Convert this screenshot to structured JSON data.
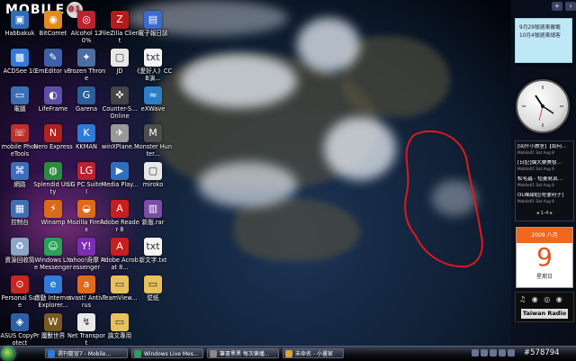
{
  "brand": {
    "logo_text": "MOBILE",
    "logo_badge": "01"
  },
  "desktop_icons": [
    {
      "name": "icon-habbakuk",
      "label": "Habbakuk",
      "color": "#2e6bb8",
      "glyph": "▣"
    },
    {
      "name": "icon-bitcomet",
      "label": "BitComet",
      "color": "#e48a1b",
      "glyph": "◉"
    },
    {
      "name": "icon-alcohol",
      "label": "Alcohol 120%",
      "color": "#b8232e",
      "glyph": "◎"
    },
    {
      "name": "icon-filezilla",
      "label": "FileZilla Client",
      "color": "#b51b1b",
      "glyph": "Z"
    },
    {
      "name": "icon-ultraedit",
      "label": "電子報日誌",
      "color": "#3b6bd1",
      "glyph": "▤"
    },
    {
      "name": "icon-acdsee",
      "label": "ACDSee 10",
      "color": "#2f7bd9",
      "glyph": "▩"
    },
    {
      "name": "icon-emeditor",
      "label": "EmEditor v3",
      "color": "#3f5fa8",
      "glyph": "✎"
    },
    {
      "name": "icon-frozen-throne",
      "label": "Frozen Throne",
      "color": "#4d6fa0",
      "glyph": "✦"
    },
    {
      "name": "icon-jd",
      "label": "JD",
      "color": "#e8e8e8",
      "glyph": "▢"
    },
    {
      "name": "icon-ccb",
      "label": "《愛好人》CCB演...",
      "color": "#f4f4f4",
      "glyph": "txt"
    },
    {
      "name": "icon-computer",
      "label": "電腦",
      "color": "#3a6fb8",
      "glyph": "▭"
    },
    {
      "name": "icon-lifeframe",
      "label": "LifeFrame",
      "color": "#5d4fa8",
      "glyph": "◐"
    },
    {
      "name": "icon-garena",
      "label": "Garena",
      "color": "#2a5f99",
      "glyph": "G"
    },
    {
      "name": "icon-counter-strike",
      "label": "Counter-S... Online",
      "color": "#444",
      "glyph": "✜"
    },
    {
      "name": "icon-wave",
      "label": "eXWave",
      "color": "#2b7fc9",
      "glyph": "≈"
    },
    {
      "name": "icon-mobile-phonetools",
      "label": "mobile PhoneTools",
      "color": "#be2e2e",
      "glyph": "☏"
    },
    {
      "name": "icon-nero-express",
      "label": "Nero Express",
      "color": "#ad2222",
      "glyph": "N"
    },
    {
      "name": "icon-kkman",
      "label": "KKMAN",
      "color": "#2d7bd4",
      "glyph": "K"
    },
    {
      "name": "icon-winxplane",
      "label": "winXPlane...",
      "color": "#999",
      "glyph": "✈"
    },
    {
      "name": "icon-monster-hunter",
      "label": "Monster Hunter...",
      "color": "#4d4d4d",
      "glyph": "M"
    },
    {
      "name": "icon-network",
      "label": "網路",
      "color": "#3a6fb8",
      "glyph": "⌘"
    },
    {
      "name": "icon-splendid-utility",
      "label": "Splendid Utility",
      "color": "#2b8a3e",
      "glyph": "◍"
    },
    {
      "name": "icon-lg-pc-suite",
      "label": "LG PC Suite II",
      "color": "#b8232e",
      "glyph": "LG"
    },
    {
      "name": "icon-media-player",
      "label": "Media Play...",
      "color": "#2f6fbf",
      "glyph": "▶"
    },
    {
      "name": "icon-miroko",
      "label": "miroko",
      "color": "#e8e8e8",
      "glyph": "▢"
    },
    {
      "name": "icon-control-panel",
      "label": "控制台",
      "color": "#3f6fb0",
      "glyph": "▦"
    },
    {
      "name": "icon-winamp",
      "label": "Winamp",
      "color": "#d86a1a",
      "glyph": "⚡"
    },
    {
      "name": "icon-firefox",
      "label": "Mozilla Firefox",
      "color": "#e06a1a",
      "glyph": "◒"
    },
    {
      "name": "icon-adobe-reader",
      "label": "Adobe Reader 8",
      "color": "#c81e1e",
      "glyph": "A"
    },
    {
      "name": "icon-winrar",
      "label": "新版.rar",
      "color": "#7a4ea8",
      "glyph": "▥"
    },
    {
      "name": "icon-recycle-bin",
      "label": "資源回收筒",
      "color": "#8aa6c8",
      "glyph": "♻"
    },
    {
      "name": "icon-windows-live-messenger",
      "label": "Windows Live Messenger",
      "color": "#2aa05a",
      "glyph": "☺"
    },
    {
      "name": "icon-yahoo-messenger",
      "label": "Yahoo!奇摩 Messenger",
      "color": "#7b2fb0",
      "glyph": "Y!"
    },
    {
      "name": "icon-adobe-acrobat",
      "label": "Adobe Acrobat 8...",
      "color": "#c81e1e",
      "glyph": "A"
    },
    {
      "name": "icon-text-file",
      "label": "新文字.txt",
      "color": "#f4f4f4",
      "glyph": "txt"
    },
    {
      "name": "icon-personal-safe",
      "label": "Personal Safe",
      "color": "#c8261e",
      "glyph": "⊙"
    },
    {
      "name": "icon-internet-explorer",
      "label": "啟動 Internet Explorer...",
      "color": "#2f7bd9",
      "glyph": "e"
    },
    {
      "name": "icon-avast",
      "label": "avast! Antivirus",
      "color": "#e06a1a",
      "glyph": "a"
    },
    {
      "name": "icon-teamviewer",
      "label": "TeamView...",
      "color": "#e8c15a",
      "glyph": "▭"
    },
    {
      "name": "icon-folder-1",
      "label": "壁紙",
      "color": "#e8c15a",
      "glyph": "▭"
    },
    {
      "name": "icon-asus-copyprotect",
      "label": "ASUS CopyProtect",
      "color": "#2d5fa8",
      "glyph": "◈"
    },
    {
      "name": "icon-warcraft",
      "label": "魔獸世界",
      "color": "#7a5a1e",
      "glyph": "W"
    },
    {
      "name": "icon-net-transport",
      "label": "Net Transport",
      "color": "#e8e8e8",
      "glyph": "↯"
    },
    {
      "name": "icon-folder-2",
      "label": "論文專用",
      "color": "#e8c15a",
      "glyph": "▭"
    }
  ],
  "gadgets": {
    "toolbar": {
      "add_label": "+",
      "nav_label": "‹"
    },
    "note": {
      "text": "9月29號週東搬電\n10月4號週東請客"
    },
    "feed": {
      "items": [
        {
          "title": "[回升小教室]【如何...",
          "source": "Mobile01 Sat Aug 8"
        },
        {
          "title": "[日記]爛大樂美發...",
          "source": "Mobile01 Sat Aug 8"
        },
        {
          "title": "松毛蟲 - 短菱寫真...",
          "source": "Mobile01 Sat Aug 8"
        },
        {
          "title": "OL裸甜粒[吃便利子]",
          "source": "Mobile01 Sat Aug 8"
        }
      ],
      "pager": "◂ 1-4 ▸"
    },
    "calendar": {
      "month": "2009 八月",
      "day": "9",
      "weekday": "星期日"
    },
    "radio": {
      "icons": "♫ ◉ ◎ ◉",
      "label": "Taiwan Radio"
    }
  },
  "taskbar": {
    "tasks": [
      {
        "label": "週刊藍宣7 - Mobile..."
      },
      {
        "label": "Windows Live Mes..."
      },
      {
        "label": "筆書黑黑 每次樂播..."
      },
      {
        "label": "未命名 - 小畫家"
      }
    ]
  },
  "watermark": "#5787​94"
}
